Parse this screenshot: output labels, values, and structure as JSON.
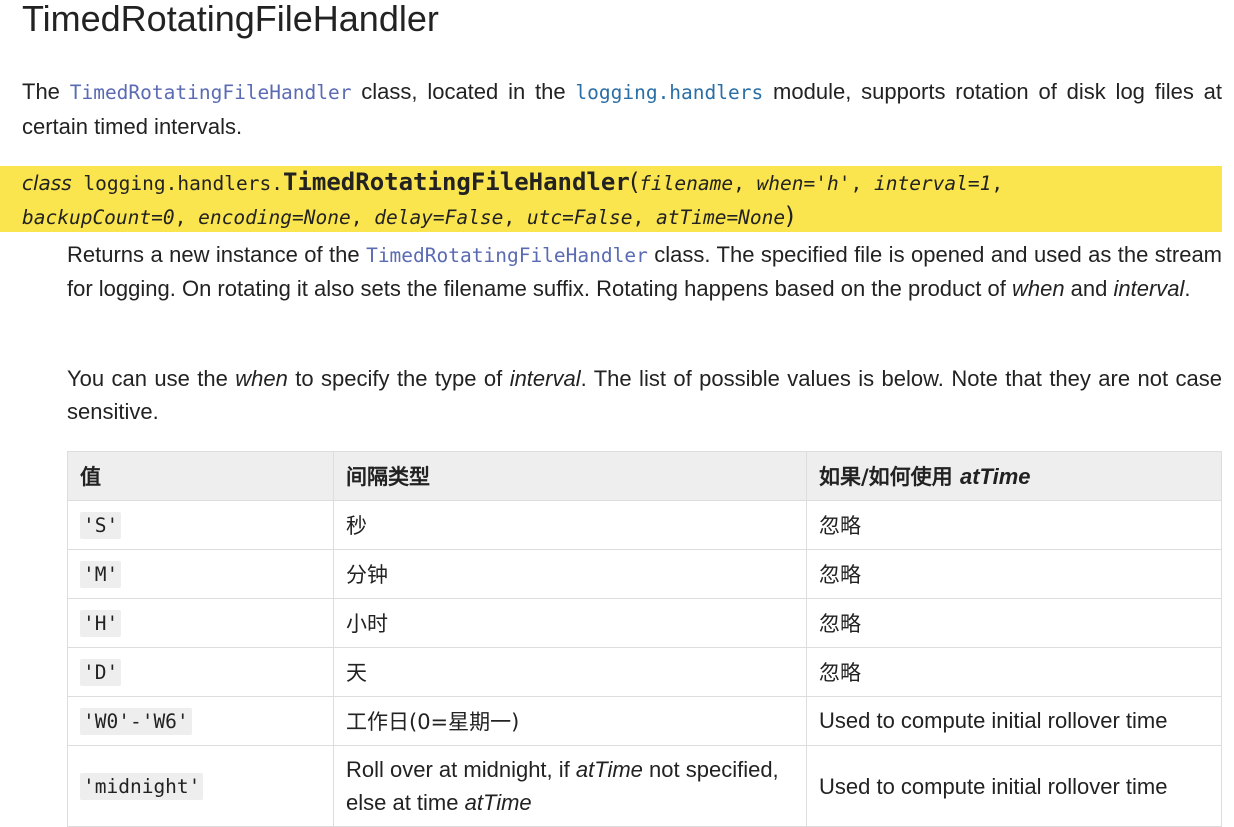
{
  "heading": "TimedRotatingFileHandler",
  "intro": {
    "p1": "The ",
    "class_ref": "TimedRotatingFileHandler",
    "p2": " class, located in the ",
    "module_ref": "logging.handlers",
    "p3": " module, supports rotation of disk log files at certain timed intervals."
  },
  "signature": {
    "keyword": "class",
    "module_prefix": "logging.handlers.",
    "name": "TimedRotatingFileHandler",
    "open_paren": "(",
    "close_paren": ")",
    "params": [
      "filename",
      "when='h'",
      "interval=1",
      "backupCount=0",
      "encoding=None",
      "delay=False",
      "utc=False",
      "atTime=None"
    ]
  },
  "description": {
    "d1_a": "Returns a new instance of the ",
    "d1_ref": "TimedRotatingFileHandler",
    "d1_b": " class. The specified file is opened and used as the stream for logging. On rotating it also sets the filename suffix. Rotating happens based on the product of ",
    "d1_when": "when",
    "d1_and": " and ",
    "d1_interval": "interval",
    "d1_end": ".",
    "d2_a": "You can use the ",
    "d2_when": "when",
    "d2_b": " to specify the type of ",
    "d2_interval": "interval",
    "d2_c": ". The list of possible values is below. Note that they are not case sensitive."
  },
  "table": {
    "headers": {
      "value": "值",
      "interval_type": "间隔类型",
      "attime_prefix": "如果/如何使用 ",
      "attime_em": "atTime"
    },
    "rows": [
      {
        "value": "'S'",
        "type": "秒",
        "usage": "忽略"
      },
      {
        "value": "'M'",
        "type": "分钟",
        "usage": "忽略"
      },
      {
        "value": "'H'",
        "type": "小时",
        "usage": "忽略"
      },
      {
        "value": "'D'",
        "type": "天",
        "usage": "忽略"
      },
      {
        "value": "'W0'-'W6'",
        "type": "工作日(0=星期一)",
        "usage": "Used to compute initial rollover time"
      }
    ],
    "midnight_row": {
      "value": "'midnight'",
      "type_a": "Roll over at midnight, if ",
      "type_em1": "atTime",
      "type_b": " not specified, else at time ",
      "type_em2": "atTime",
      "usage": "Used to compute initial rollover time"
    }
  }
}
